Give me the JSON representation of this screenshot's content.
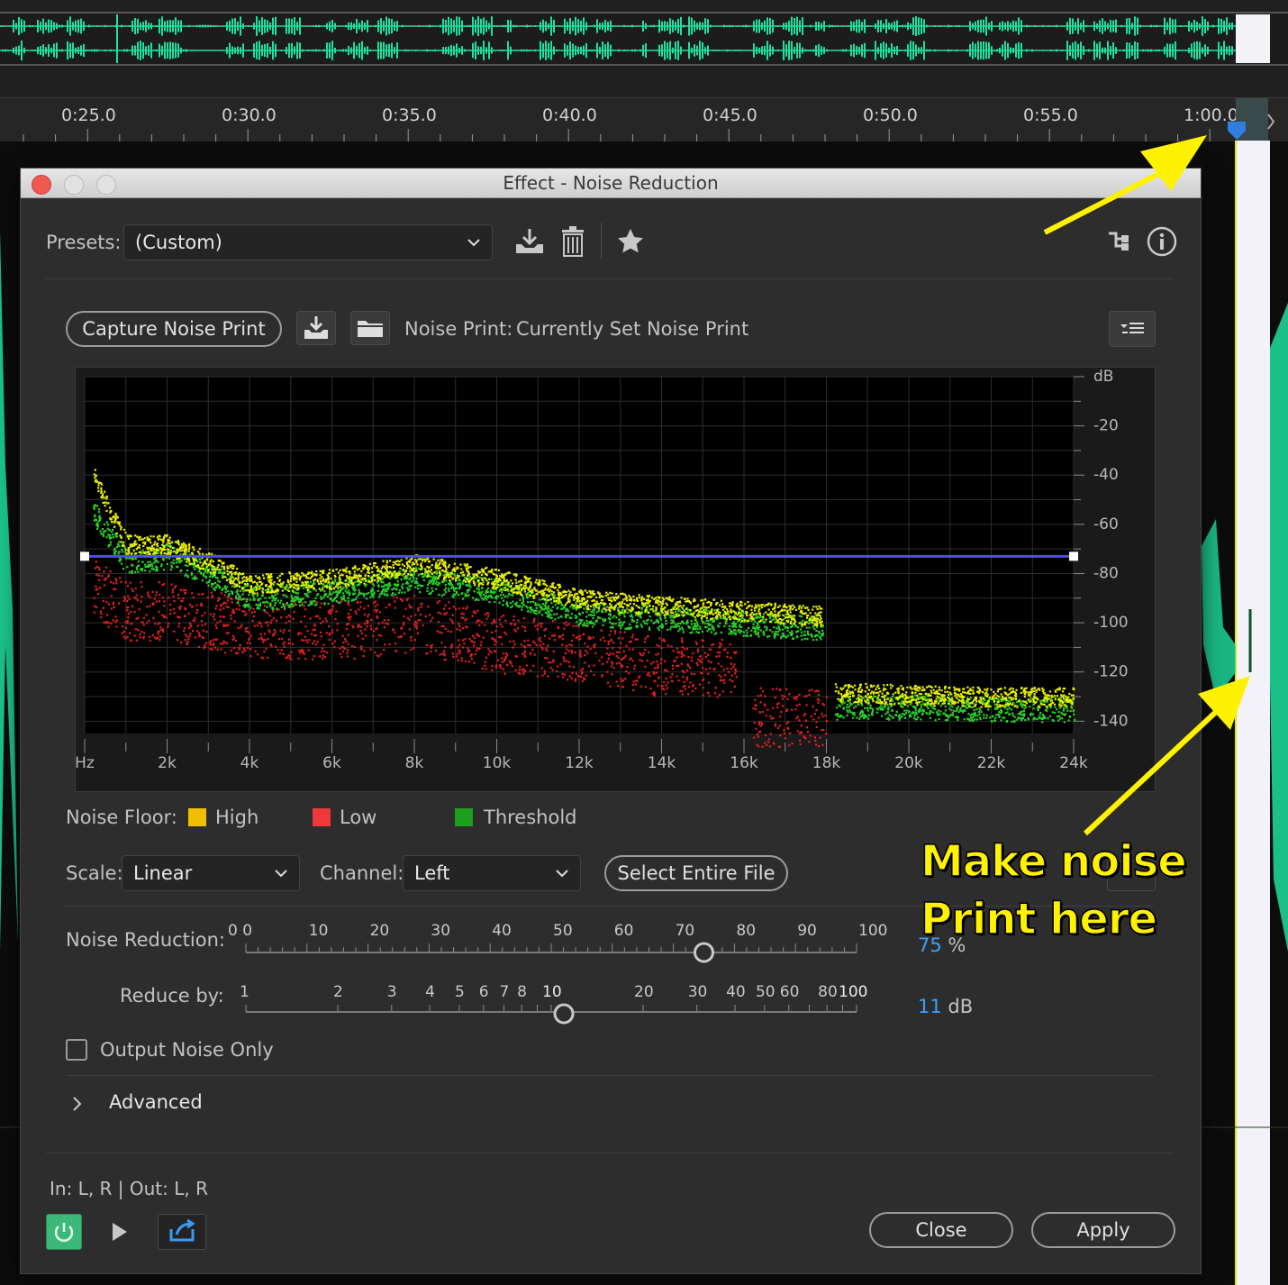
{
  "timeline": {
    "ticks": [
      "0:25.0",
      "0:30.0",
      "0:35.0",
      "0:40.0",
      "0:45.0",
      "0:50.0",
      "0:55.0",
      "1:00.0"
    ]
  },
  "dialog": {
    "title": "Effect - Noise Reduction",
    "presets_label": "Presets:",
    "preset_value": "(Custom)",
    "capture_button": "Capture Noise Print",
    "noise_print_label": "Noise Print:",
    "noise_print_value": "Currently Set Noise Print",
    "legend_title": "Noise Floor:",
    "legend": [
      {
        "label": "High",
        "color": "#f0c000"
      },
      {
        "label": "Low",
        "color": "#f03838"
      },
      {
        "label": "Threshold",
        "color": "#1ea01e"
      }
    ],
    "scale_label": "Scale:",
    "scale_value": "Linear",
    "channel_label": "Channel:",
    "channel_value": "Left",
    "select_entire_file": "Select Entire File",
    "noise_reduction_label": "Noise Reduction:",
    "noise_reduction_scale": [
      "0 0",
      "10",
      "20",
      "30",
      "40",
      "50",
      "60",
      "70",
      "80",
      "90",
      "100"
    ],
    "noise_reduction_value": "75",
    "noise_reduction_unit": "%",
    "reduce_by_label": "Reduce by:",
    "reduce_by_scale": [
      "1",
      "2",
      "3",
      "4",
      "5",
      "6",
      "7",
      "8",
      "10",
      "20",
      "30",
      "40",
      "50",
      "60",
      "80",
      "100"
    ],
    "reduce_by_value": "11",
    "reduce_by_unit": "dB",
    "output_noise_only": "Output Noise Only",
    "advanced": "Advanced",
    "io_text": "In: L, R | Out: L, R",
    "close_button": "Close",
    "apply_button": "Apply"
  },
  "annotation": {
    "line1": "Make noise",
    "line2": "Print here",
    "color": "#fff200"
  },
  "chart_data": {
    "type": "scatter",
    "x_unit": "Hz",
    "y_unit": "dB",
    "x_ticks": [
      "Hz",
      "2k",
      "4k",
      "6k",
      "8k",
      "10k",
      "12k",
      "14k",
      "16k",
      "18k",
      "20k",
      "22k",
      "24k"
    ],
    "y_ticks": [
      "dB",
      "-20",
      "-40",
      "-60",
      "-80",
      "-100",
      "-120",
      "-140"
    ],
    "xlim": [
      0,
      24000
    ],
    "ylim": [
      -145,
      0
    ],
    "threshold_line_db": -73,
    "series": [
      {
        "name": "High",
        "color": "#e8f000",
        "x": [
          200,
          1000,
          2000,
          3000,
          4000,
          6000,
          8000,
          10000,
          12000,
          14000,
          16000,
          17900,
          18200,
          20000,
          22000,
          24000
        ],
        "y": [
          -40,
          -68,
          -68,
          -75,
          -84,
          -82,
          -76,
          -82,
          -90,
          -93,
          -95,
          -97,
          -128,
          -129,
          -130,
          -130
        ]
      },
      {
        "name": "Threshold",
        "color": "#2ad02a",
        "x": [
          200,
          1000,
          2000,
          3000,
          4000,
          6000,
          8000,
          10000,
          12000,
          14000,
          16000,
          17900,
          18200,
          20000,
          22000,
          24000
        ],
        "y": [
          -55,
          -75,
          -73,
          -80,
          -90,
          -87,
          -82,
          -87,
          -96,
          -98,
          -100,
          -102,
          -134,
          -134,
          -135,
          -135
        ]
      },
      {
        "name": "Low",
        "color": "#e02020",
        "x": [
          200,
          1000,
          2000,
          4000,
          6000,
          8000,
          10000,
          12000,
          14000,
          15800,
          16200,
          18000
        ],
        "y": [
          -85,
          -95,
          -95,
          -102,
          -103,
          -100,
          -108,
          -112,
          -118,
          -118,
          -138,
          -138
        ]
      }
    ]
  }
}
